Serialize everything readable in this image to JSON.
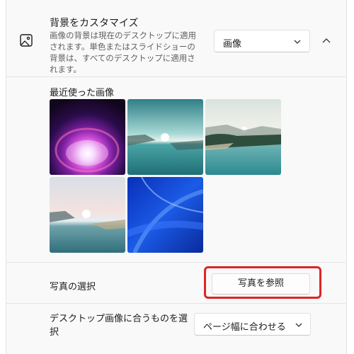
{
  "personalize": {
    "title": "背景をカスタマイズ",
    "description": "画像の背景は現在のデスクトップに適用されます。単色またはスライドショーの背景は、すべてのデスクトップに適用されます。",
    "background_type": "画像",
    "expand_icon": "chevron-up-icon",
    "section_icon": "image-icon"
  },
  "recent_images": {
    "label": "最近使った画像",
    "images": [
      {
        "name": "purple-glow"
      },
      {
        "name": "lake-sunrise-teal"
      },
      {
        "name": "lake-forest-shore"
      },
      {
        "name": "lake-sunset-pink"
      },
      {
        "name": "blue-abstract"
      }
    ]
  },
  "choose_photo": {
    "label": "写真の選択",
    "button_label": "写真を参照"
  },
  "fit": {
    "label": "デスクトップ画像に合うものを選択",
    "value": "ページ幅に合わせる"
  },
  "colors": {
    "highlight": "#e02424",
    "accent": "#0067c0"
  }
}
